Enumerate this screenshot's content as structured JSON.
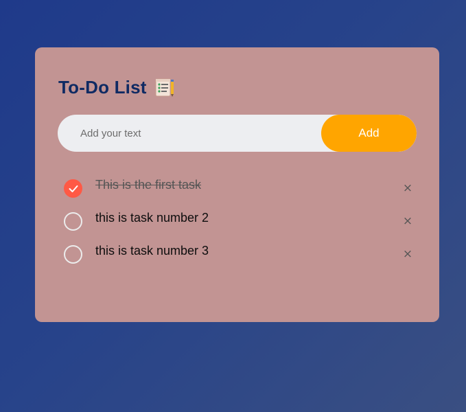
{
  "app": {
    "title": "To-Do List",
    "title_icon": "checklist-notepad-icon"
  },
  "input": {
    "placeholder": "Add your text",
    "value": ""
  },
  "add_button": {
    "label": "Add"
  },
  "tasks": [
    {
      "text": "This is the first task",
      "completed": true,
      "delete_label": "×"
    },
    {
      "text": "this is task number 2",
      "completed": false,
      "delete_label": "×"
    },
    {
      "text": "this is task number 3",
      "completed": false,
      "delete_label": "×"
    }
  ],
  "colors": {
    "background_start": "#1f3a8a",
    "background_end": "#3a4f82",
    "card": "#c29493",
    "title": "#0f2a63",
    "accent": "#ffa500",
    "check_done": "#ff5945",
    "input_bg": "#edeef1"
  }
}
